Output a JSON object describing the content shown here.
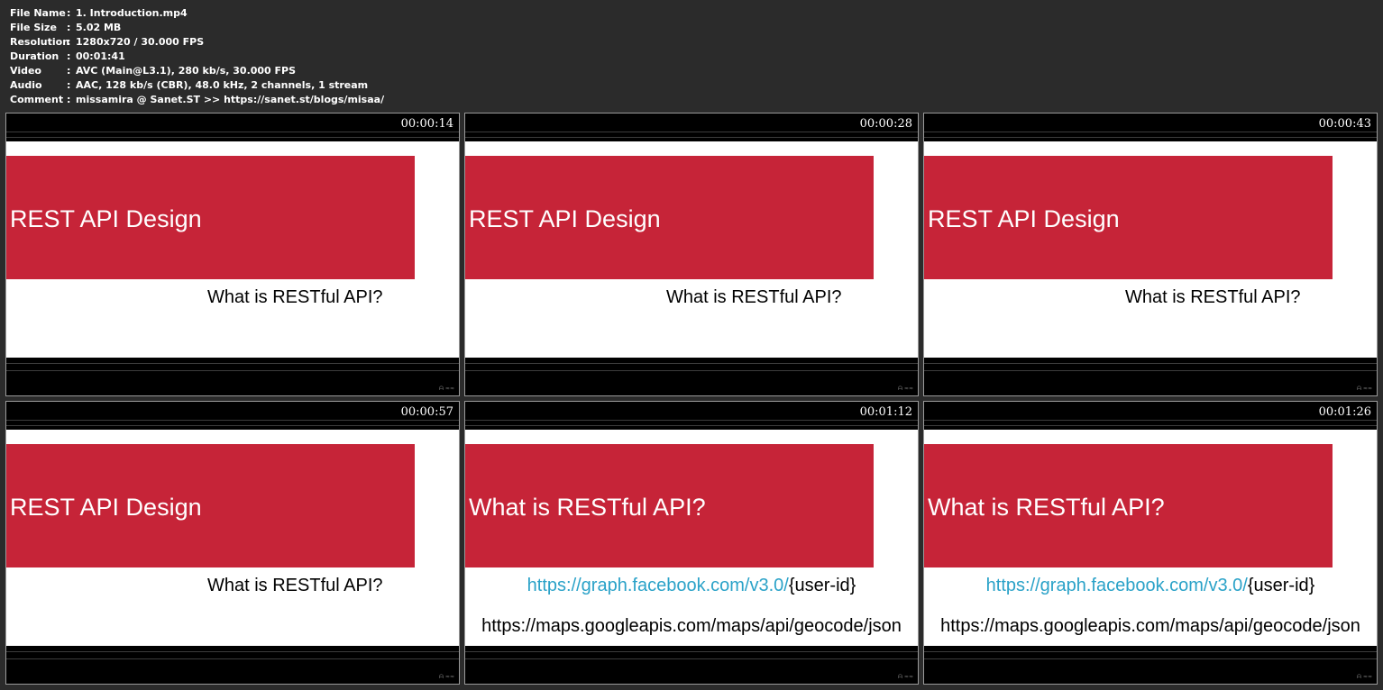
{
  "file_info": [
    {
      "key": "File Name",
      "value": "1. Introduction.mp4"
    },
    {
      "key": "File Size",
      "value": "5.02 MB"
    },
    {
      "key": "Resolution",
      "value": "1280x720 / 30.000 FPS"
    },
    {
      "key": "Duration",
      "value": "00:01:41"
    },
    {
      "key": "Video",
      "value": "AVC (Main@L3.1), 280 kb/s, 30.000 FPS"
    },
    {
      "key": "Audio",
      "value": "AAC, 128 kb/s (CBR), 48.0 kHz, 2 channels, 1 stream"
    },
    {
      "key": "Comment",
      "value": "missamira @ Sanet.ST  >> https://sanet.st/blogs/misaa/"
    }
  ],
  "separator": ":",
  "colors": {
    "banner": "#c62438",
    "link": "#2aa2c8",
    "background": "#2b2b2b"
  },
  "thumbnails": [
    {
      "timestamp": "00:00:14",
      "banner": "REST API Design",
      "subtitle": "What is RESTful API?"
    },
    {
      "timestamp": "00:00:28",
      "banner": "REST API Design",
      "subtitle": "What is RESTful API?"
    },
    {
      "timestamp": "00:00:43",
      "banner": "REST API Design",
      "subtitle": "What is RESTful API?"
    },
    {
      "timestamp": "00:00:57",
      "banner": "REST API Design",
      "subtitle": "What is RESTful API?"
    },
    {
      "timestamp": "00:01:12",
      "banner": "What is RESTful API?",
      "url1_link": "https://graph.facebook.com/v3.0/",
      "url1_param": "{user-id}",
      "url2": "https://maps.googleapis.com/maps/api/geocode/json"
    },
    {
      "timestamp": "00:01:26",
      "banner": "What is RESTful API?",
      "url1_link": "https://graph.facebook.com/v3.0/",
      "url1_param": "{user-id}",
      "url2": "https://maps.googleapis.com/maps/api/geocode/json"
    }
  ]
}
